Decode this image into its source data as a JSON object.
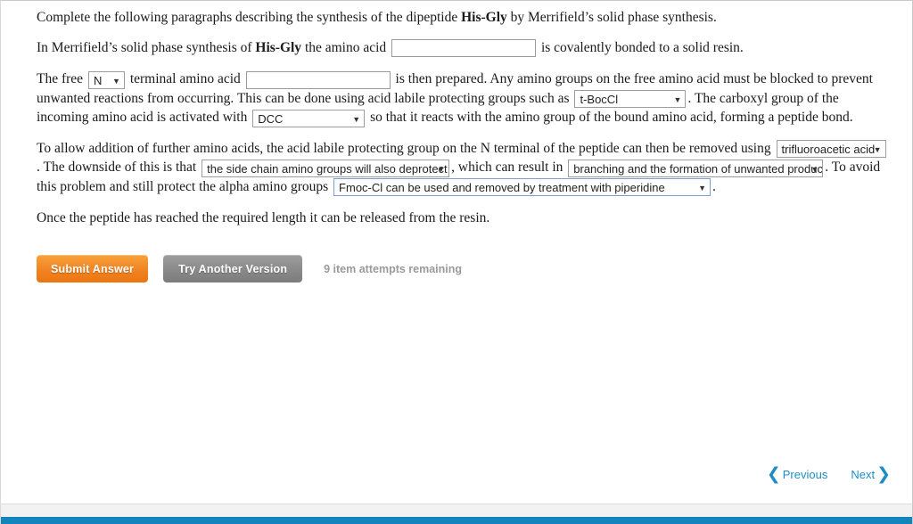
{
  "question": {
    "intro": {
      "before_bold": "Complete the following paragraphs describing the synthesis of the dipeptide ",
      "bold": "His-Gly",
      "after_bold": " by Merrifield’s solid phase synthesis."
    },
    "paragraph1": {
      "part1": "In Merrifield’s solid phase synthesis of ",
      "bold": "His-Gly",
      "part2": " the amino acid ",
      "part3": " is covalently bonded to a solid resin."
    },
    "paragraph2": {
      "part1": "The free ",
      "part2": " terminal amino acid ",
      "part3": " is then prepared. Any amino groups on the free amino acid must be blocked to prevent unwanted reactions from occurring. This can be done using acid labile protecting groups such as ",
      "part4": ". The carboxyl group of the incoming amino acid is activated with ",
      "part5": " so that it reacts with the amino group of the bound amino acid, forming a peptide bond."
    },
    "paragraph3": {
      "part1": "To allow addition of further amino acids, the acid labile protecting group on the N terminal of the peptide can then be removed using ",
      "part2": ". The downside of this is that ",
      "part3": ", which can result in ",
      "part4": ". To avoid this problem and still protect the alpha amino groups ",
      "part5": "."
    },
    "paragraph4": "Once the peptide has reached the required length it can be released from the resin."
  },
  "inputs": {
    "resin_amino_acid": {
      "value": "",
      "placeholder": ""
    },
    "terminal_amino_acid": {
      "value": "",
      "placeholder": ""
    }
  },
  "dropdowns": {
    "terminal": {
      "value": "N",
      "caret": "▼"
    },
    "protecting_group": {
      "value": "t-BocCl",
      "caret": "▼"
    },
    "activator": {
      "value": "DCC",
      "caret": "▼"
    },
    "deprotect_reagent": {
      "value": "trifluoroacetic acid",
      "caret": "▼"
    },
    "side_chain": {
      "value": "the side chain amino groups will also deprotect",
      "caret": "▼"
    },
    "result": {
      "value": "branching and the formation of unwanted products",
      "caret": "▼"
    },
    "fmoc": {
      "value": "Fmoc-Cl can be used and removed by treatment with piperidine",
      "caret": "▼"
    }
  },
  "actions": {
    "submit_label": "Submit Answer",
    "try_another_label": "Try Another Version",
    "attempts_text": "9 item attempts remaining"
  },
  "navigation": {
    "previous_label": "Previous",
    "previous_chevron": "❮",
    "next_label": "Next",
    "next_chevron": "❯"
  },
  "colors": {
    "submit_orange": "#ef8020",
    "try_another_gray": "#8a8a8a",
    "link_blue": "#1f8dc4",
    "footer_bar_blue": "#1385bd",
    "attempts_gray": "#9a9a9a"
  }
}
